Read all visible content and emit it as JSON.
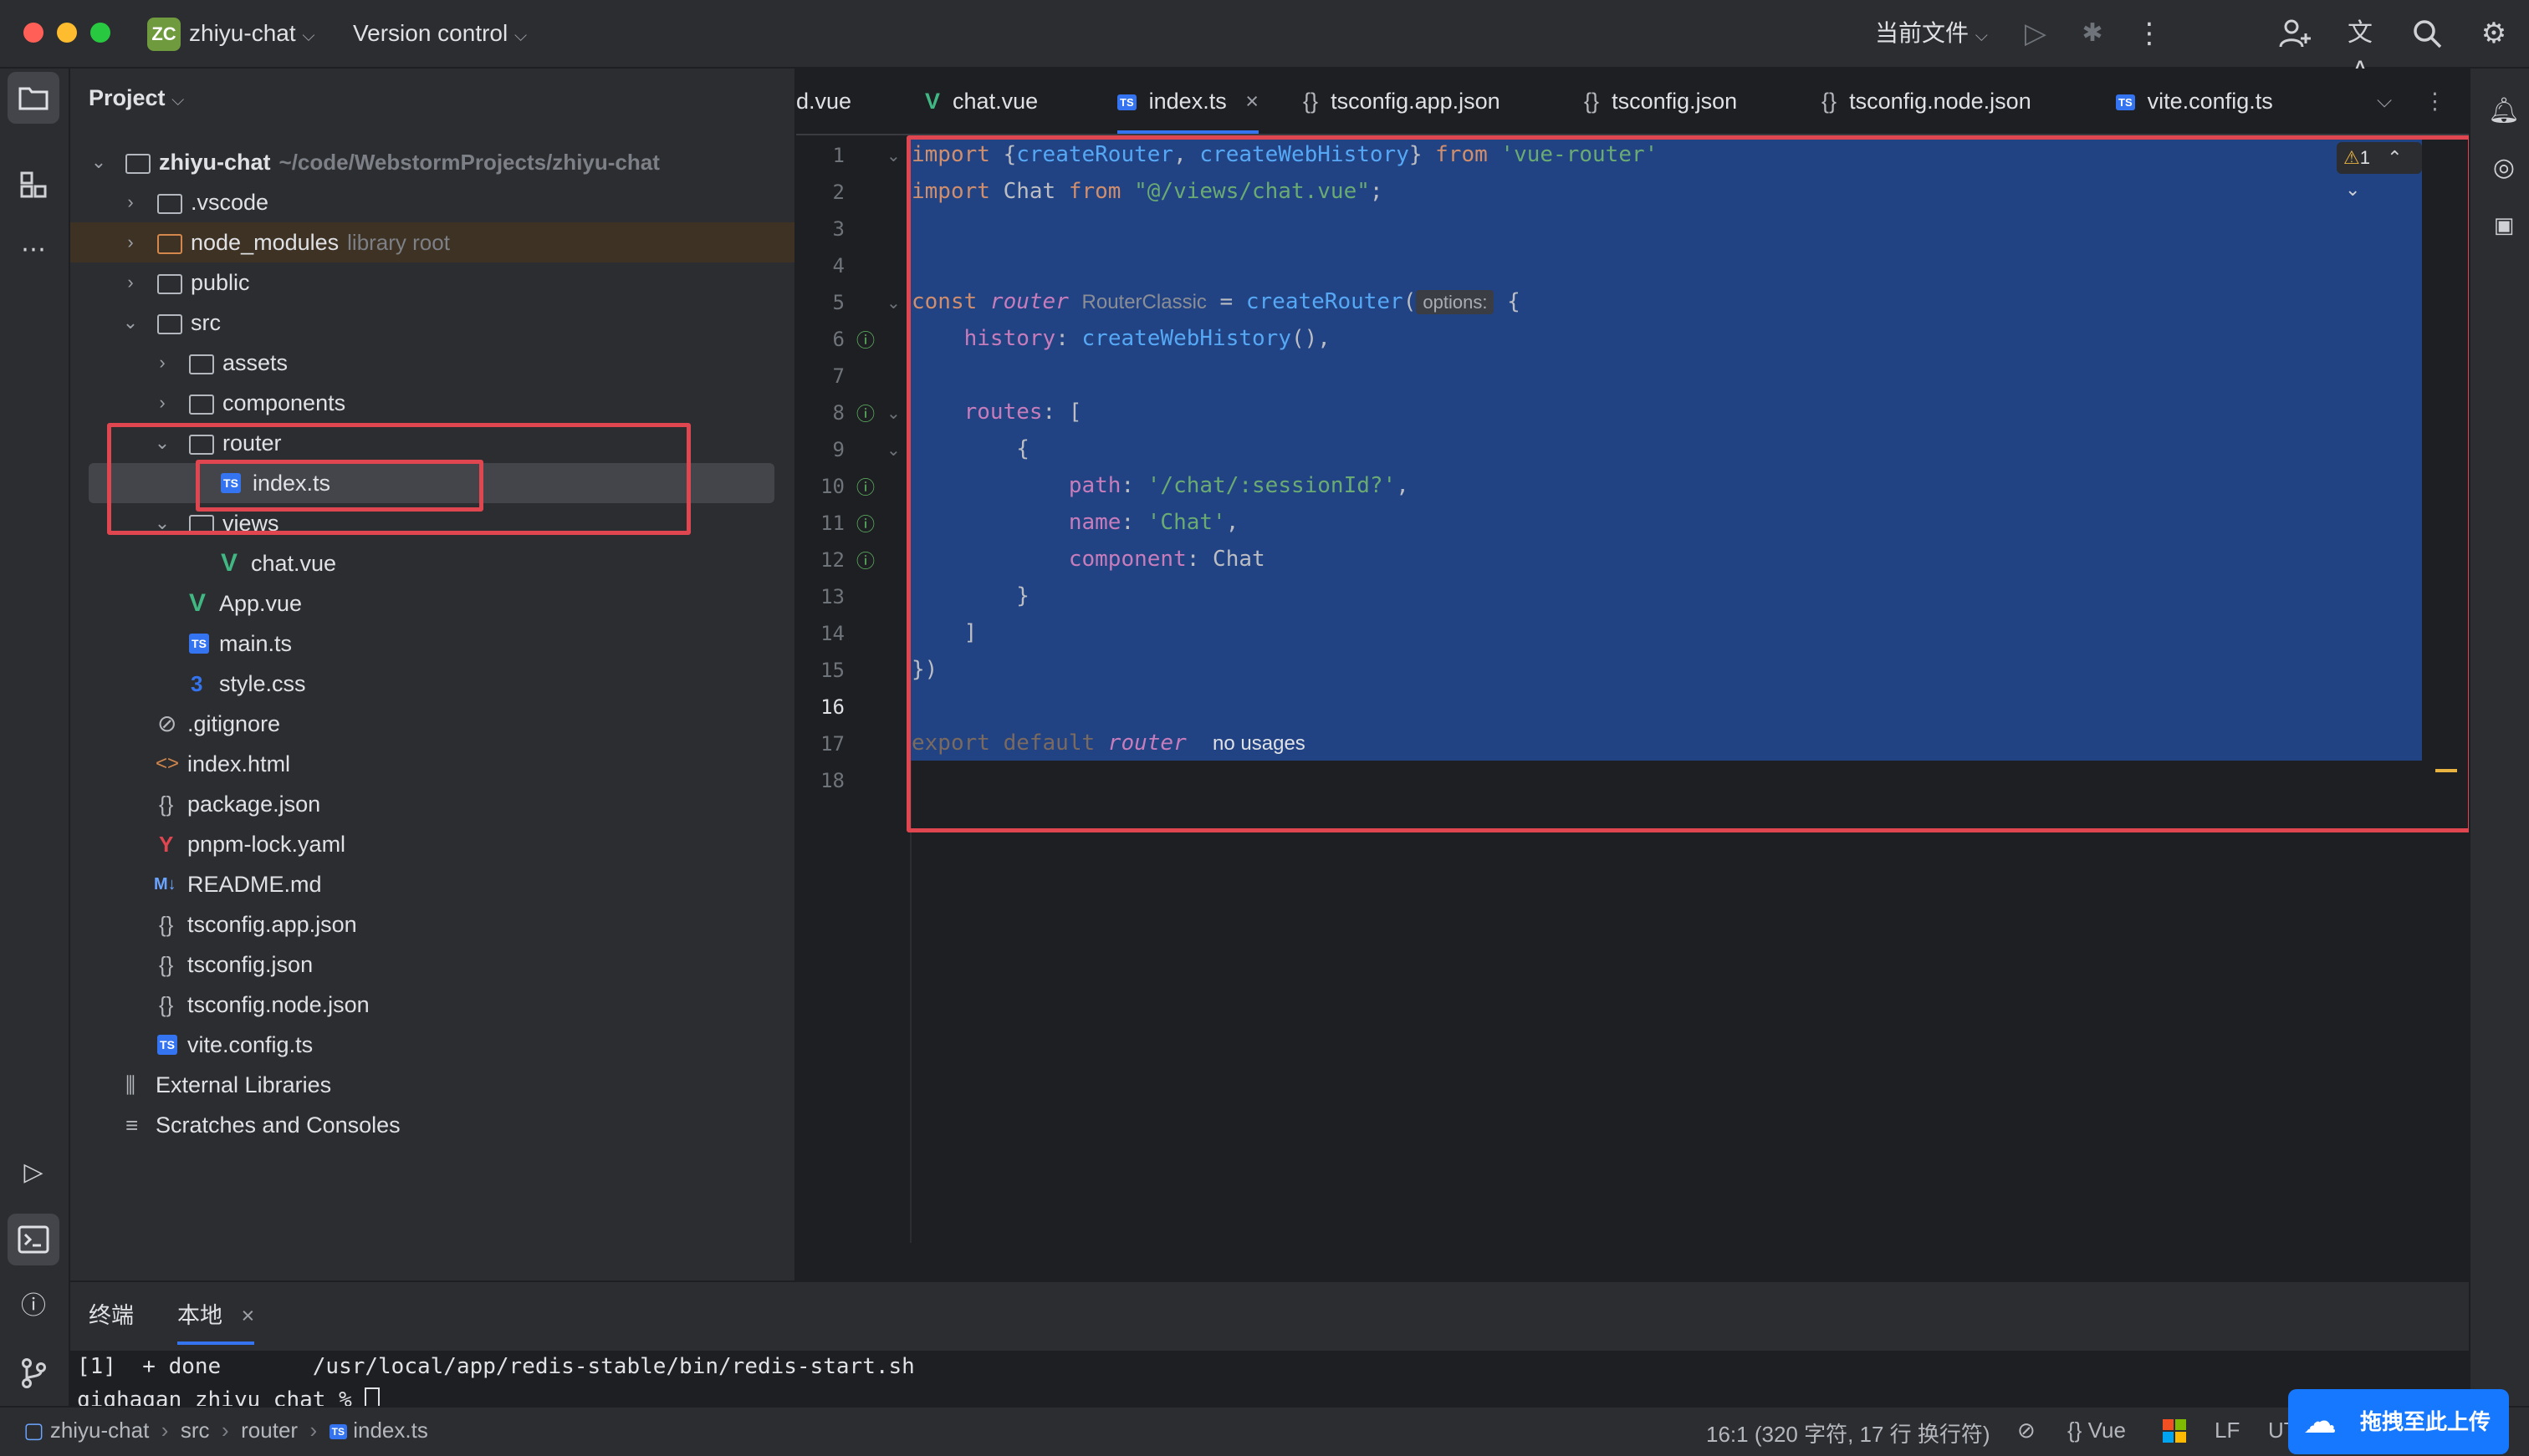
{
  "titlebar": {
    "project_badge": "ZC",
    "project_name": "zhiyu-chat",
    "vcs": "Version control",
    "run_config": "当前文件"
  },
  "project_panel": {
    "title": "Project",
    "root_name": "zhiyu-chat",
    "root_path": "~/code/WebstormProjects/zhiyu-chat",
    "items": [
      {
        "label": "zhiyu-chat",
        "hint": "~/code/WebstormProjects/zhiyu-chat"
      },
      {
        "label": ".vscode"
      },
      {
        "label": "node_modules",
        "hint": "library root"
      },
      {
        "label": "public"
      },
      {
        "label": "src"
      },
      {
        "label": "assets"
      },
      {
        "label": "components"
      },
      {
        "label": "router"
      },
      {
        "label": "index.ts"
      },
      {
        "label": "views"
      },
      {
        "label": "chat.vue"
      },
      {
        "label": "App.vue"
      },
      {
        "label": "main.ts"
      },
      {
        "label": "style.css"
      },
      {
        "label": ".gitignore"
      },
      {
        "label": "index.html"
      },
      {
        "label": "package.json"
      },
      {
        "label": "pnpm-lock.yaml"
      },
      {
        "label": "README.md"
      },
      {
        "label": "tsconfig.app.json"
      },
      {
        "label": "tsconfig.json"
      },
      {
        "label": "tsconfig.node.json"
      },
      {
        "label": "vite.config.ts"
      },
      {
        "label": "External Libraries"
      },
      {
        "label": "Scratches and Consoles"
      }
    ]
  },
  "tabs": [
    {
      "label": "d.vue"
    },
    {
      "label": "chat.vue"
    },
    {
      "label": "index.ts",
      "active": true
    },
    {
      "label": "tsconfig.app.json"
    },
    {
      "label": "tsconfig.json"
    },
    {
      "label": "tsconfig.node.json"
    },
    {
      "label": "vite.config.ts"
    }
  ],
  "editor": {
    "warning_count": "1",
    "line_numbers": [
      "1",
      "2",
      "3",
      "4",
      "5",
      "6",
      "7",
      "8",
      "9",
      "10",
      "11",
      "12",
      "13",
      "14",
      "15",
      "16",
      "17",
      "18"
    ],
    "code": {
      "l1_import": "import",
      "l1_open": " {",
      "l1_fn1": "createRouter",
      "l1_comma": ", ",
      "l1_fn2": "createWebHistory",
      "l1_close": "} ",
      "l1_from": "from",
      "l1_str": " 'vue-router'",
      "l2_import": "import",
      "l2_mid": " Chat ",
      "l2_from": "from",
      "l2_str": " \"@/views/chat.vue\"",
      "l2_end": ";",
      "l5_const": "const",
      "l5_var": " router",
      "l5_hint": "RouterClassic",
      "l5_eq": " = ",
      "l5_fn": "createRouter",
      "l5_paren": "(",
      "l5_opt": "options:",
      "l5_brace": " {",
      "l6_prop": "history",
      "l6_colon": ": ",
      "l6_fn": "createWebHistory",
      "l6_end": "(),",
      "l8_prop": "routes",
      "l8_end": ": [",
      "l9": "{",
      "l10_prop": "path",
      "l10_colon": ": ",
      "l10_str": "'/chat/:sessionId?'",
      "l10_end": ",",
      "l11_prop": "name",
      "l11_colon": ": ",
      "l11_str": "'Chat'",
      "l11_end": ",",
      "l12_prop": "component",
      "l12_rest": ": Chat",
      "l13": "}",
      "l14": "]",
      "l15": "})",
      "l17_export": "export default",
      "l17_var": " router",
      "l17_hint": "no usages"
    }
  },
  "terminal": {
    "tab_main": "终端",
    "tab_local": "本地",
    "line1": "[1]  + done       /usr/local/app/redis-stable/bin/redis-start.sh",
    "line2": "qiqhagan zhiyu chat %"
  },
  "statusbar": {
    "crumb1": "zhiyu-chat",
    "crumb2": "src",
    "crumb3": "router",
    "crumb4": "index.ts",
    "position": "16:1 (320 字符, 17 行 换行符)",
    "lang": "Vue",
    "lf": "LF",
    "enc": "UT"
  },
  "upload_button": "拖拽至此上传"
}
